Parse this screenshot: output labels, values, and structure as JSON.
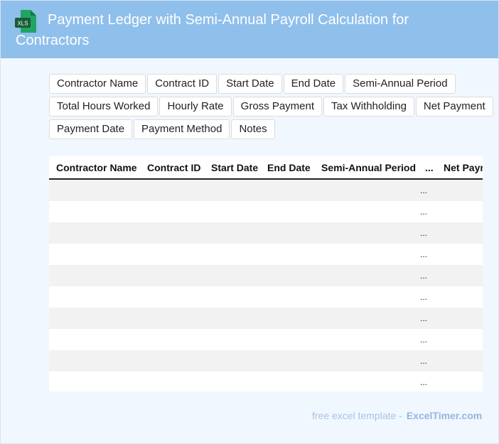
{
  "header": {
    "title": "Payment Ledger with Semi-Annual Payroll Calculation for Contractors",
    "icon": "xls-file-icon",
    "icon_label": "XLS",
    "color": "#8fbfeb"
  },
  "tag_rows": [
    [
      "Contractor Name",
      "Contract ID",
      "Start Date",
      "End Date",
      "Semi-Annual Period"
    ],
    [
      "Total Hours Worked",
      "Hourly Rate",
      "Gross Payment",
      "Tax Withholding",
      "Net Payment"
    ],
    [
      "Payment Date",
      "Payment Method",
      "Notes"
    ]
  ],
  "table": {
    "columns": [
      "Contractor Name",
      "Contract ID",
      "Start Date",
      "End Date",
      "Semi-Annual Period",
      "...",
      "Net Payment"
    ],
    "rows": [
      [
        "",
        "",
        "",
        "",
        "",
        "...",
        ""
      ],
      [
        "",
        "",
        "",
        "",
        "",
        "...",
        ""
      ],
      [
        "",
        "",
        "",
        "",
        "",
        "...",
        ""
      ],
      [
        "",
        "",
        "",
        "",
        "",
        "...",
        ""
      ],
      [
        "",
        "",
        "",
        "",
        "",
        "...",
        ""
      ],
      [
        "",
        "",
        "",
        "",
        "",
        "...",
        ""
      ],
      [
        "",
        "",
        "",
        "",
        "",
        "...",
        ""
      ],
      [
        "",
        "",
        "",
        "",
        "",
        "...",
        ""
      ],
      [
        "",
        "",
        "",
        "",
        "",
        "...",
        ""
      ],
      [
        "",
        "",
        "",
        "",
        "",
        "...",
        ""
      ]
    ]
  },
  "footer": {
    "text": "free excel template -",
    "brand": "ExcelTimer.com"
  }
}
